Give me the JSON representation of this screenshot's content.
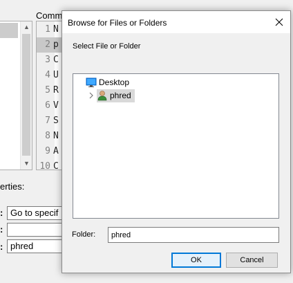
{
  "background": {
    "comm_label": "Comm",
    "props_label": "erties:",
    "code_lines": [
      {
        "num": "1",
        "text": "N"
      },
      {
        "num": "2",
        "text": "p"
      },
      {
        "num": "3",
        "text": "C"
      },
      {
        "num": "4",
        "text": "U"
      },
      {
        "num": "5",
        "text": "R"
      },
      {
        "num": "6",
        "text": "V"
      },
      {
        "num": "7",
        "text": "S"
      },
      {
        "num": "8",
        "text": "N"
      },
      {
        "num": "9",
        "text": "A"
      },
      {
        "num": "10",
        "text": "C"
      }
    ],
    "fields": [
      {
        "label": ":",
        "value": "Go to specif"
      },
      {
        "label": ":",
        "value": ""
      },
      {
        "label": ":",
        "value": "phred"
      }
    ]
  },
  "dialog": {
    "title": "Browse for Files or Folders",
    "prompt": "Select File or Folder",
    "tree": [
      {
        "label": "Desktop",
        "icon": "desktop-icon"
      },
      {
        "label": "phred",
        "icon": "user-folder-icon",
        "selected": true
      }
    ],
    "folder_label": "Folder:",
    "folder_value": "phred",
    "ok_label": "OK",
    "cancel_label": "Cancel"
  },
  "colors": {
    "accent": "#0078d7",
    "selection": "#d9d9d9",
    "dialog_bg": "#f0f0f0"
  }
}
